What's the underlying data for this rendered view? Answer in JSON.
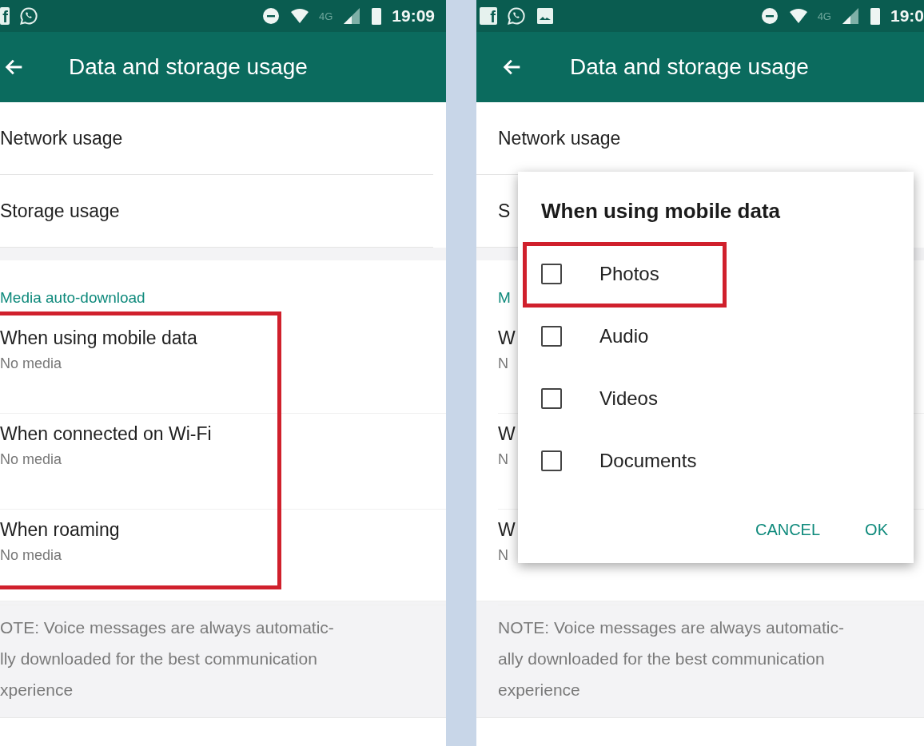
{
  "panels": [
    {
      "status_bar": {
        "notification_icons": [
          {
            "kind": "facebook",
            "glyph": "f"
          },
          {
            "kind": "whatsapp"
          }
        ],
        "network_type": "4G",
        "time": "19:09"
      },
      "app_bar": {
        "title": "Data and storage usage"
      },
      "items": [
        {
          "label": "Network usage"
        },
        {
          "label": "Storage usage"
        }
      ],
      "section": {
        "header": "Media auto-download",
        "highlighted": true,
        "rows": [
          {
            "title": "When using mobile data",
            "subtitle": "No media"
          },
          {
            "title": "When connected on Wi-Fi",
            "subtitle": "No media"
          },
          {
            "title": "When roaming",
            "subtitle": "No media"
          }
        ]
      },
      "note": [
        "OTE: Voice messages are always automatic-",
        "lly downloaded for the best communication",
        "xperience"
      ]
    },
    {
      "status_bar": {
        "notification_icons": [
          {
            "kind": "facebook",
            "glyph": "f"
          },
          {
            "kind": "whatsapp"
          },
          {
            "kind": "gallery"
          }
        ],
        "network_type": "4G",
        "time": "19:0"
      },
      "app_bar": {
        "title": "Data and storage usage"
      },
      "items": [
        {
          "label": "Network usage"
        },
        {
          "label": "S"
        }
      ],
      "section": {
        "header": "M",
        "highlighted": false,
        "rows": [
          {
            "title": "W",
            "subtitle": "N"
          },
          {
            "title": "W",
            "subtitle": "N"
          },
          {
            "title": "W",
            "subtitle": "N"
          }
        ]
      },
      "note": [
        "NOTE: Voice messages are always automatic-",
        "ally downloaded for the best communication",
        "experience"
      ],
      "dialog": {
        "title": "When using mobile data",
        "options": [
          {
            "label": "Photos",
            "checked": false,
            "highlighted": true
          },
          {
            "label": "Audio",
            "checked": false,
            "highlighted": false
          },
          {
            "label": "Videos",
            "checked": false,
            "highlighted": false
          },
          {
            "label": "Documents",
            "checked": false,
            "highlighted": false
          }
        ],
        "buttons": [
          "CANCEL",
          "OK"
        ]
      }
    }
  ]
}
